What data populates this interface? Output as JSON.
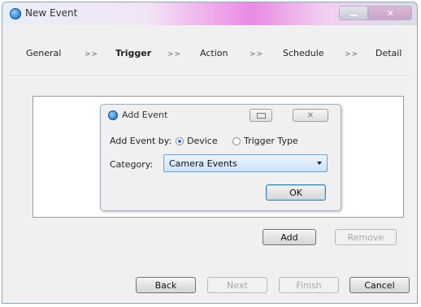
{
  "window": {
    "title": "New Event"
  },
  "steps": {
    "general": "General",
    "trigger": "Trigger",
    "action": "Action",
    "schedule": "Schedule",
    "detail": "Detail",
    "separator": ">>"
  },
  "dialog": {
    "title": "Add Event",
    "add_event_by_label": "Add Event by:",
    "radio_device": "Device",
    "radio_trigger_type": "Trigger Type",
    "selected_option": "Device",
    "category_label": "Category:",
    "category_value": "Camera Events",
    "ok_label": "OK"
  },
  "panel_buttons": {
    "add": "Add",
    "remove": "Remove"
  },
  "footer_buttons": {
    "back": "Back",
    "next": "Next",
    "finish": "Finish",
    "cancel": "Cancel"
  },
  "colors": {
    "accent": "#2a6ad6",
    "select_bg": "#cde2f8"
  }
}
